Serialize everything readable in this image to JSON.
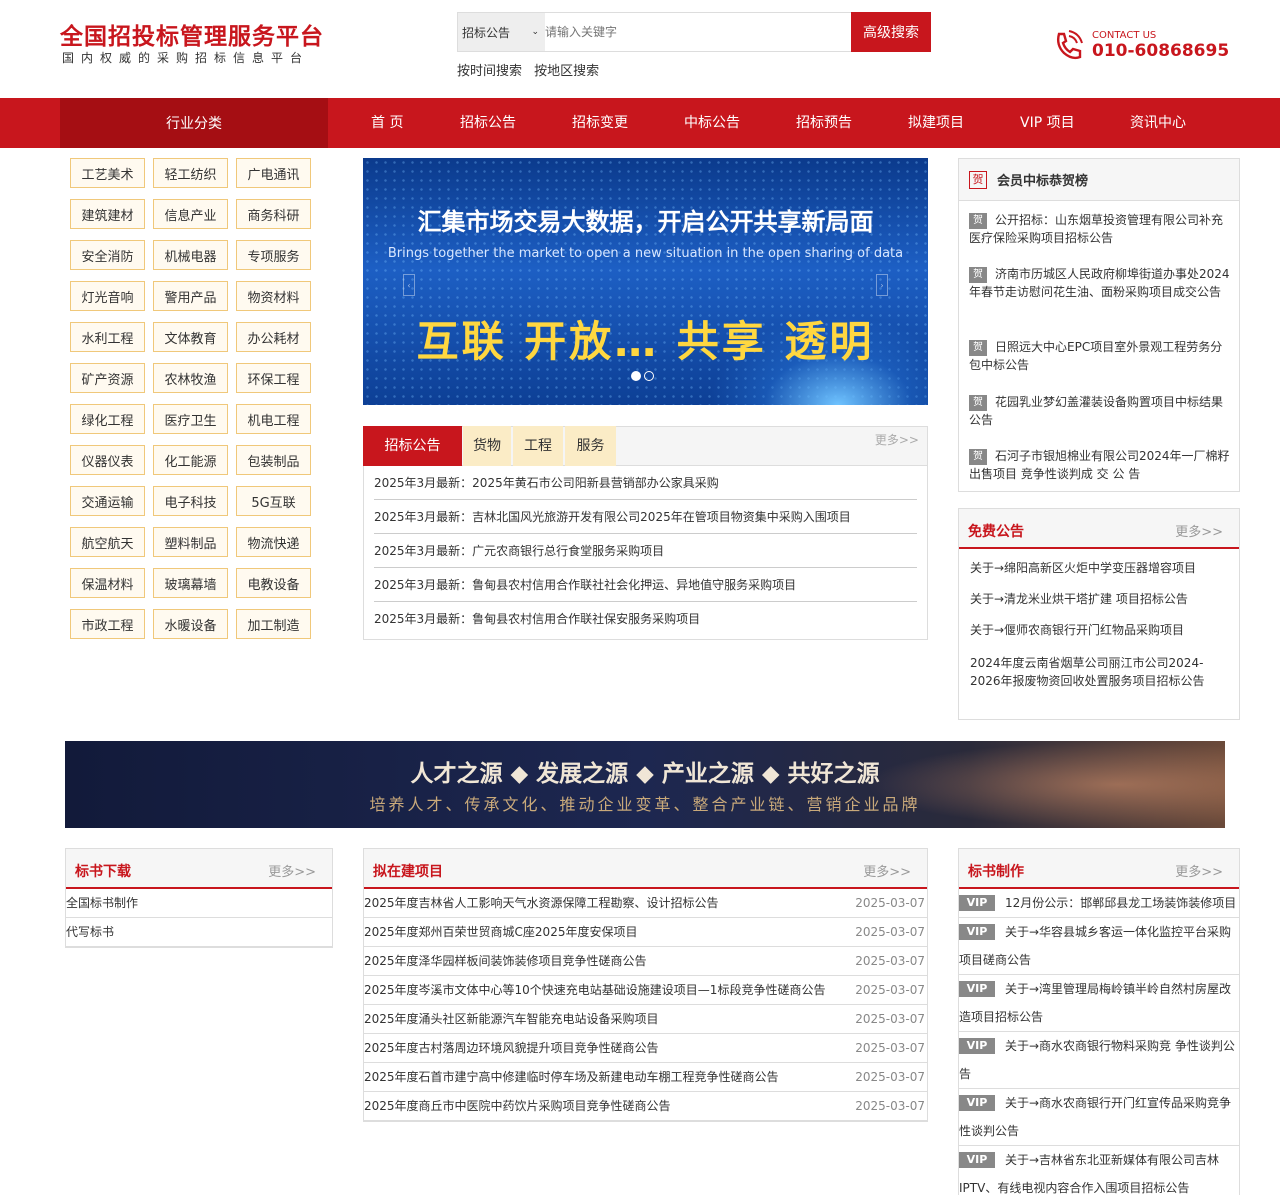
{
  "header": {
    "title": "全国招投标管理服务平台",
    "subtitle": "国内权威的采购招标信息平台",
    "search_select": "招标公告",
    "search_placeholder": "请输入关键字",
    "search_button": "高级搜索",
    "quick_links": [
      "按时间搜索",
      "按地区搜索"
    ],
    "contact_label": "CONTACT US",
    "contact_phone": "010-60868695"
  },
  "nav": {
    "category": "行业分类",
    "items": [
      "首 页",
      "招标公告",
      "招标变更",
      "中标公告",
      "招标预告",
      "拟建项目",
      "VIP 项目",
      "资讯中心"
    ]
  },
  "categories": [
    "工艺美术",
    "轻工纺织",
    "广电通讯",
    "建筑建材",
    "信息产业",
    "商务科研",
    "安全消防",
    "机械电器",
    "专项服务",
    "灯光音响",
    "警用产品",
    "物资材料",
    "水利工程",
    "文体教育",
    "办公耗材",
    "矿产资源",
    "农林牧渔",
    "环保工程",
    "绿化工程",
    "医疗卫生",
    "机电工程",
    "仪器仪表",
    "化工能源",
    "包装制品",
    "交通运输",
    "电子科技",
    "5G互联",
    "航空航天",
    "塑料制品",
    "物流快递",
    "保温材料",
    "玻璃幕墙",
    "电教设备",
    "市政工程",
    "水暖设备",
    "加工制造"
  ],
  "banner": {
    "title": "汇集市场交易大数据，开启公开共享新局面",
    "subtitle": "Brings together the market to open a new situation in the open sharing of data",
    "slogan": "互联 开放… 共享 透明"
  },
  "tabs": {
    "labels": [
      "招标公告",
      "货物",
      "工程",
      "服务"
    ],
    "more": "更多>>",
    "rows": [
      "2025年3月最新：2025年黄石市公司阳新县营销部办公家具采购",
      "2025年3月最新：吉林北国风光旅游开发有限公司2025年在管项目物资集中采购入围项目",
      "2025年3月最新：广元农商银行总行食堂服务采购项目",
      "2025年3月最新：鲁甸县农村信用合作联社社会化押运、异地值守服务采购项目",
      "2025年3月最新：鲁甸县农村信用合作联社保安服务采购项目"
    ]
  },
  "rank": {
    "title": "会员中标恭贺榜",
    "badge": "贺",
    "items": [
      "公开招标：山东烟草投资管理有限公司补充医疗保险采购项目招标公告",
      "济南市历城区人民政府柳埠街道办事处2024年春节走访慰问花生油、面粉采购项目成交公告",
      "日照远大中心EPC项目室外景观工程劳务分包中标公告",
      "花园乳业梦幻盖灌装设备购置项目中标结果公告",
      "石河子市银旭棉业有限公司2024年一厂棉籽出售项目 竞争性谈判成 交 公 告"
    ]
  },
  "free": {
    "title": "免费公告",
    "more": "更多>>",
    "items": [
      "关于→绵阳高新区火炬中学变压器增容项目",
      "关于→清龙米业烘干塔扩建 项目招标公告",
      "关于→偃师农商银行开门红物品采购项目",
      "2024年度云南省烟草公司丽江市公司2024-2026年报废物资回收处置服务项目招标公告"
    ]
  },
  "promo": {
    "title": "人才之源 ◆ 发展之源 ◆ 产业之源 ◆ 共好之源",
    "subtitle": "培养人才、传承文化、推动企业变革、整合产业链、营销企业品牌"
  },
  "download": {
    "title": "标书下载",
    "more": "更多>>",
    "items": [
      "全国标书制作",
      "代写标书"
    ]
  },
  "planned": {
    "title": "拟在建项目",
    "more": "更多>>",
    "rows": [
      {
        "text": "2025年度吉林省人工影响天气水资源保障工程勘察、设计招标公告",
        "date": "2025-03-07"
      },
      {
        "text": "2025年度郑州百荣世贸商城C座2025年度安保项目",
        "date": "2025-03-07"
      },
      {
        "text": "2025年度泽华园样板间装饰装修项目竞争性磋商公告",
        "date": "2025-03-07"
      },
      {
        "text": "2025年度岑溪市文体中心等10个快速充电站基础设施建设项目—1标段竞争性磋商公告",
        "date": "2025-03-07"
      },
      {
        "text": "2025年度涌头社区新能源汽车智能充电站设备采购项目",
        "date": "2025-03-07"
      },
      {
        "text": "2025年度古村落周边环境风貌提升项目竞争性磋商公告",
        "date": "2025-03-07"
      },
      {
        "text": "2025年度石首市建宁高中修建临时停车场及新建电动车棚工程竞争性磋商公告",
        "date": "2025-03-07"
      },
      {
        "text": "2025年度商丘市中医院中药饮片采购项目竞争性磋商公告",
        "date": "2025-03-07"
      }
    ]
  },
  "make": {
    "title": "标书制作",
    "more": "更多>>",
    "badge": "VIP",
    "items": [
      "12月份公示：邯郸邱县龙工场装饰装修项目",
      "关于→华容县城乡客运一体化监控平台采购项目磋商公告",
      "关于→湾里管理局梅岭镇半岭自然村房屋改造项目招标公告",
      "关于→商水农商银行物料采购竞 争性谈判公告",
      "关于→商水农商银行开门红宣传品采购竞争性谈判公告",
      "关于→吉林省东北亚新媒体有限公司吉林IPTV、有线电视内容合作入围项目招标公告"
    ]
  },
  "colors": {
    "brand_red": "#c8161d",
    "nav_dark": "#a50e13",
    "tab_gold": "#fbecc6"
  }
}
